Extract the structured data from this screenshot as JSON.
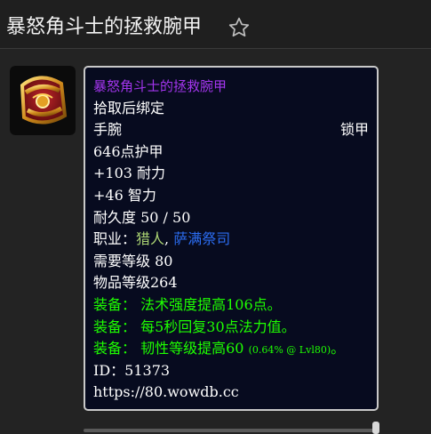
{
  "header": {
    "title": "暴怒角斗士的拯救腕甲",
    "favorite_icon": "star-outline-icon"
  },
  "item": {
    "icon": "red-gold-bracer-icon",
    "name": "暴怒角斗士的拯救腕甲",
    "name_color": "#a335ee",
    "bind": "拾取后绑定",
    "slot": "手腕",
    "armor_type": "锁甲",
    "armor": "646点护甲",
    "stats": [
      "+103 耐力",
      "+46 智力"
    ],
    "durability": "耐久度 50 / 50",
    "classes_label": "职业：",
    "classes": [
      "猎人",
      "萨满祭司"
    ],
    "classes_separator": ", ",
    "required_level": "需要等级 80",
    "item_level": "物品等级264",
    "equips": [
      {
        "prefix": "装备：",
        "text": "法术强度提高106点。"
      },
      {
        "prefix": "装备：",
        "text": "每5秒回复30点法力值。"
      },
      {
        "prefix": "装备：",
        "text": "韧性等级提高60",
        "note": "(0.64% @ Lvl80)",
        "suffix": "。"
      }
    ],
    "id_label": "ID：",
    "id": "51373",
    "url": "https://80.wowdb.cc"
  }
}
